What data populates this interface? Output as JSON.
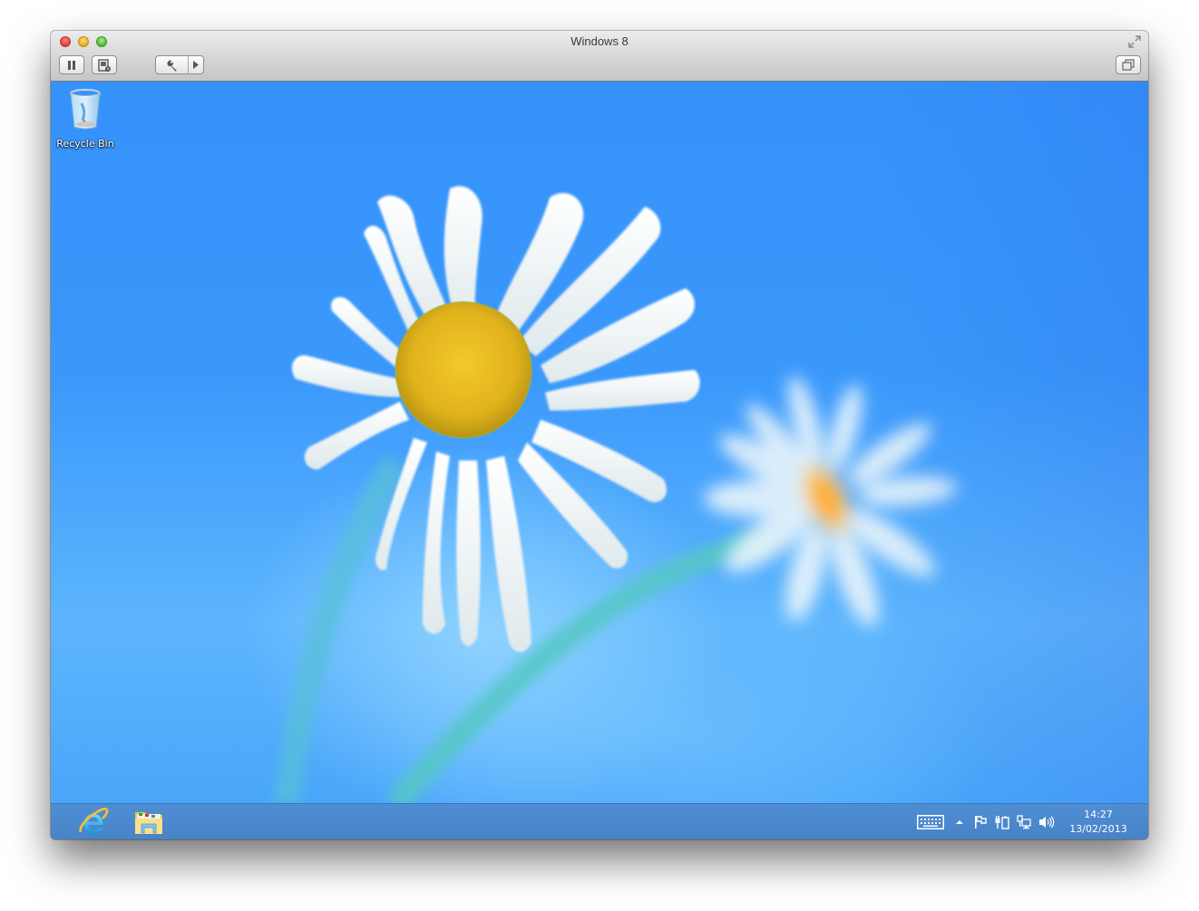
{
  "window": {
    "title": "Windows 8",
    "toolbar": {
      "pause": {
        "icon": "pause-icon",
        "label": "Pause"
      },
      "snapshot": {
        "icon": "snapshot-icon",
        "label": "Snapshot"
      },
      "settings": {
        "icon": "wrench-icon",
        "menu_icon": "triangle-right-icon",
        "label": "Settings"
      },
      "unity": {
        "icon": "unity-windows-icon",
        "label": "Unity"
      },
      "fullscreen": {
        "icon": "expand-arrows-icon",
        "label": "Enter Full Screen"
      }
    },
    "traffic_lights": {
      "close": "#e0443e",
      "minimize": "#f0b22c",
      "zoom": "#58c13c"
    }
  },
  "desktop": {
    "wallpaper": "daisy-flowers-on-blue-sky",
    "colors": {
      "sky_top": "#3592fb",
      "sky_bottom": "#5db5fd",
      "petal": "#f4f9fb",
      "center": "#e4b81f"
    },
    "icons": [
      {
        "label": "Recycle Bin",
        "icon": "recycle-bin-icon"
      }
    ]
  },
  "taskbar": {
    "color": "#4a86cc",
    "pinned": [
      {
        "name": "Internet Explorer",
        "icon": "internet-explorer-icon"
      },
      {
        "name": "File Explorer",
        "icon": "file-explorer-icon"
      }
    ],
    "tray": {
      "icons": [
        {
          "name": "Touch keyboard",
          "icon": "keyboard-icon"
        },
        {
          "name": "Show hidden icons",
          "icon": "chevron-up-icon"
        },
        {
          "name": "Action Center",
          "icon": "flag-icon"
        },
        {
          "name": "Power",
          "icon": "power-plug-icon"
        },
        {
          "name": "Network",
          "icon": "network-icon"
        },
        {
          "name": "Volume",
          "icon": "speaker-icon"
        }
      ],
      "time": "14:27",
      "date": "13/02/2013"
    }
  }
}
